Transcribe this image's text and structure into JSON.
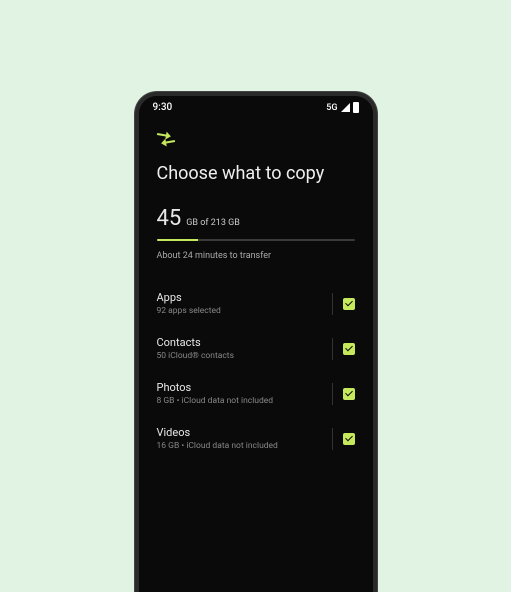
{
  "status": {
    "time": "9:30",
    "network": "5G"
  },
  "title": "Choose what to copy",
  "storage": {
    "used_value": "45",
    "used_unit_and_total": "GB of 213 GB",
    "progress_pct": 21
  },
  "eta": "About 24 minutes to transfer",
  "items": [
    {
      "title": "Apps",
      "subtitle": "92 apps selected",
      "checked": true
    },
    {
      "title": "Contacts",
      "subtitle": "50 iCloud® contacts",
      "checked": true
    },
    {
      "title": "Photos",
      "subtitle": "8 GB • iCloud data not included",
      "checked": true
    },
    {
      "title": "Videos",
      "subtitle": "16 GB • iCloud data not included",
      "checked": true
    }
  ]
}
